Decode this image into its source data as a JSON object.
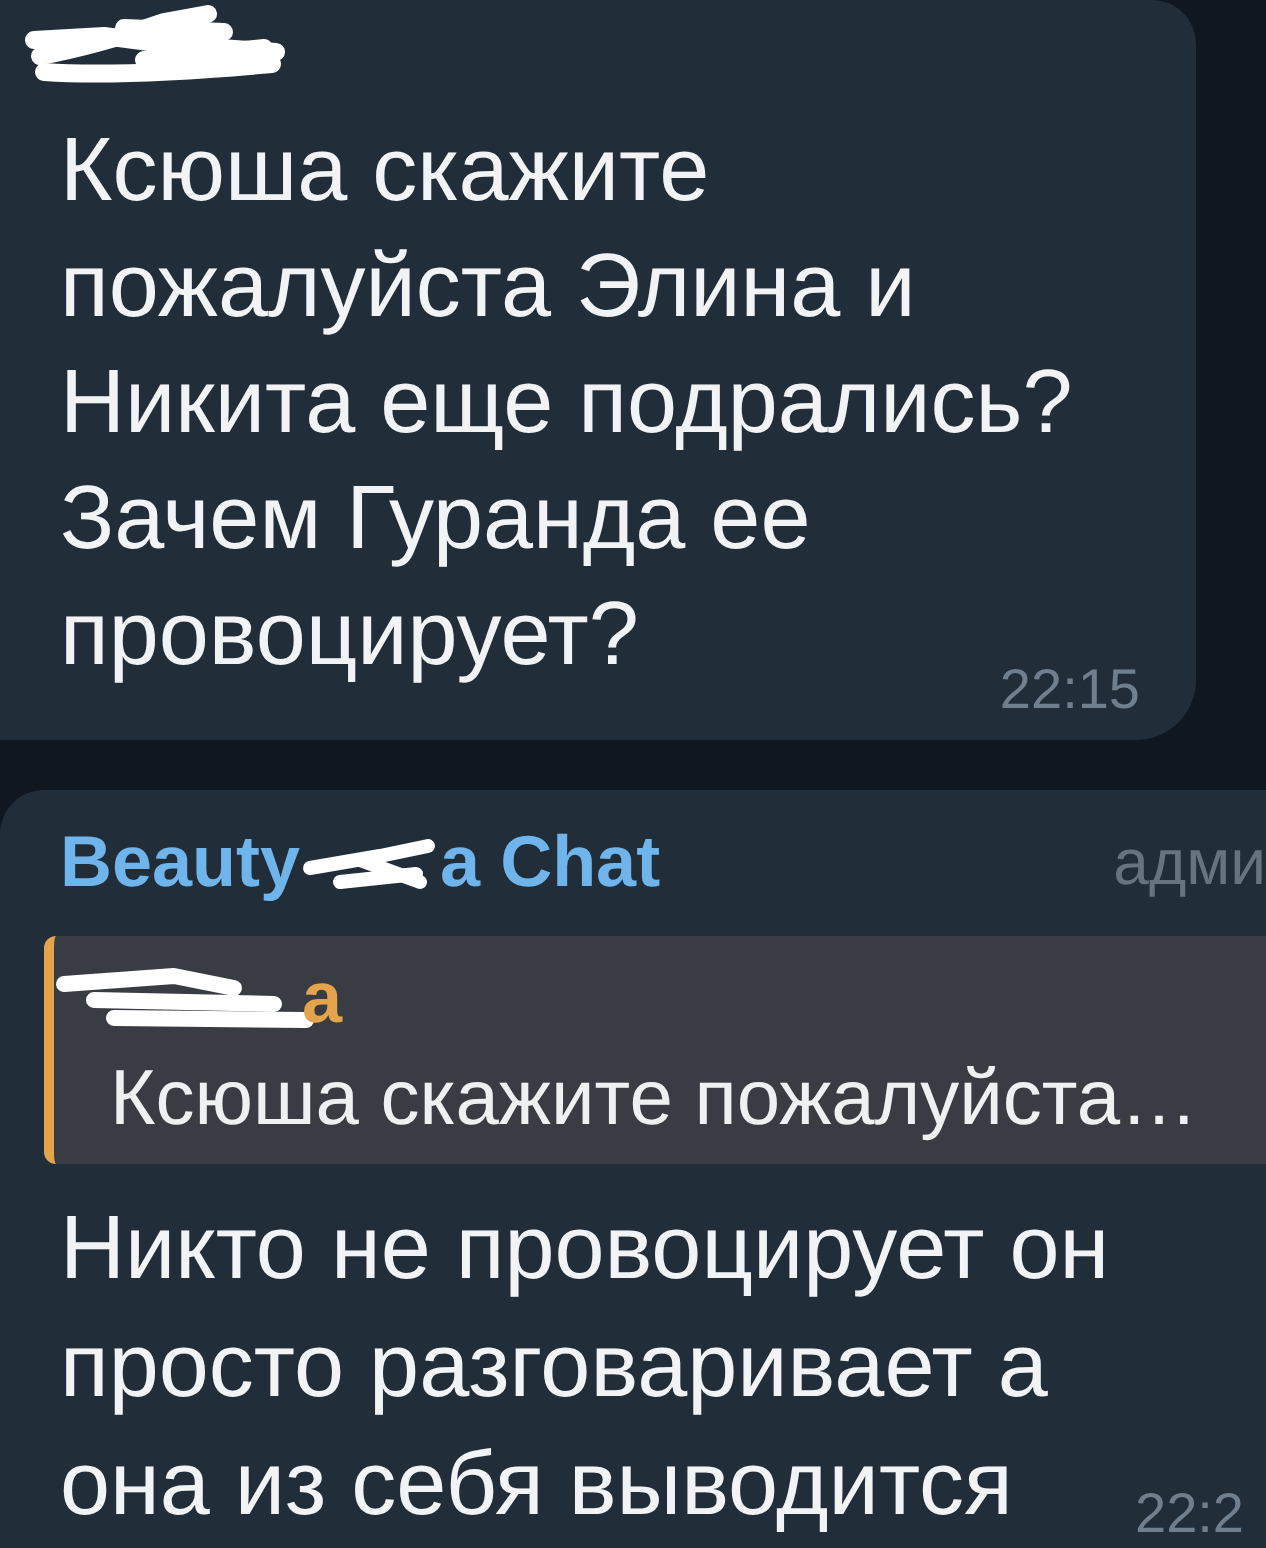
{
  "messages": [
    {
      "kind": "incoming",
      "author_redacted": true,
      "sentences": [
        [
          "Ксюша скажите",
          "пожалуйста Элина и",
          "Никита еще подрались?"
        ],
        [
          "Зачем Гуранда ее",
          "провоцирует?"
        ]
      ],
      "time": "22:15"
    },
    {
      "kind": "incoming",
      "sender": {
        "name_parts": [
          "Beauty",
          "a Chat"
        ],
        "name_redacted": true
      },
      "role": "адми",
      "reply": {
        "author_redacted": true,
        "author": "а",
        "text": "Ксюша скажите пожалуйста…"
      },
      "sentences": [
        [
          "Никто не провоцирует он",
          "просто разговаривает а",
          "она из себя выводится"
        ]
      ],
      "time": "22:2"
    }
  ]
}
